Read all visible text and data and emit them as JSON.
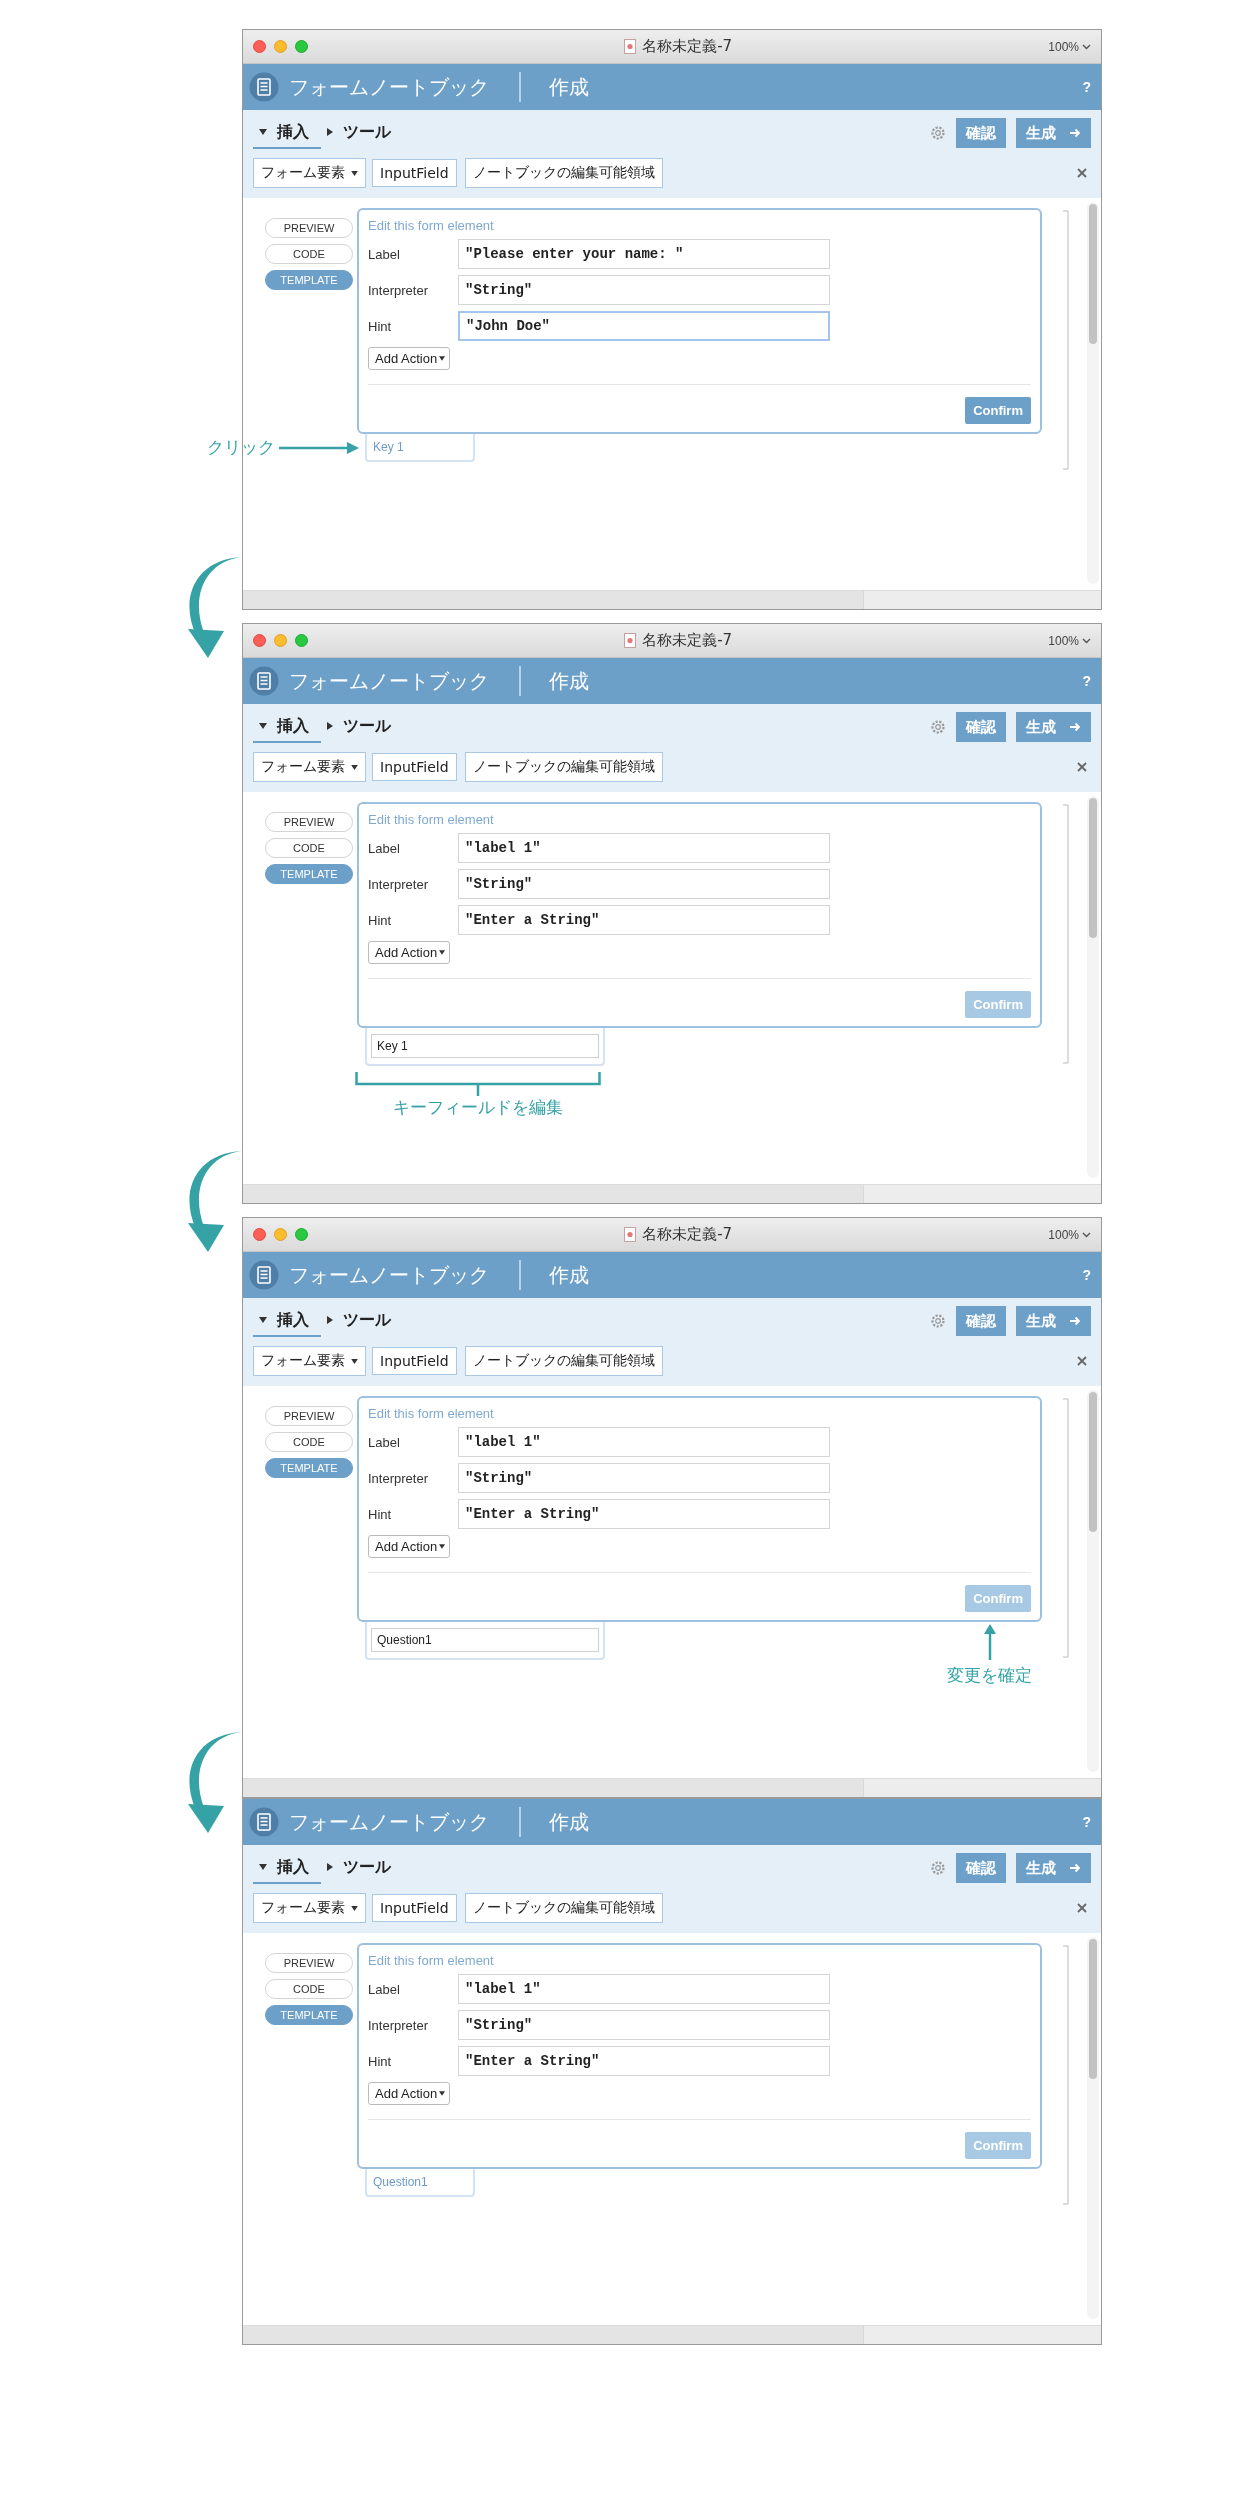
{
  "steps": [
    {
      "titlebar": {
        "title": "名称未定義-7",
        "zoom": "100%"
      },
      "header": {
        "app_name": "フォームノートブック",
        "mode": "作成",
        "help": "?"
      },
      "tabs": [
        {
          "label": "挿入",
          "expanded": true,
          "selected": true
        },
        {
          "label": "ツール",
          "expanded": false,
          "selected": false
        }
      ],
      "actions": [
        "確認",
        "生成"
      ],
      "breadcrumb": [
        "フォーム要素",
        "InputField",
        "ノートブックの編集可能領域"
      ],
      "view_modes": [
        {
          "label": "PREVIEW",
          "selected": false
        },
        {
          "label": "CODE",
          "selected": false
        },
        {
          "label": "TEMPLATE",
          "selected": true
        }
      ],
      "editor": {
        "title": "Edit this form element",
        "fields": [
          {
            "label": "Label",
            "value": "\"Please enter your name: \"",
            "focused": false
          },
          {
            "label": "Interpreter",
            "value": "\"String\"",
            "focused": false
          },
          {
            "label": "Hint",
            "value": "\"John Doe\"",
            "focused": true
          }
        ],
        "add_action": "Add Action",
        "confirm": {
          "label": "Confirm",
          "disabled": false
        }
      },
      "key_field": {
        "value": "Key 1",
        "editing": false
      },
      "annotation": {
        "kind": "arrow-left",
        "text": "クリック"
      }
    },
    {
      "titlebar": {
        "title": "名称未定義-7",
        "zoom": "100%"
      },
      "header": {
        "app_name": "フォームノートブック",
        "mode": "作成",
        "help": "?"
      },
      "tabs": [
        {
          "label": "挿入",
          "expanded": true,
          "selected": true
        },
        {
          "label": "ツール",
          "expanded": false,
          "selected": false
        }
      ],
      "actions": [
        "確認",
        "生成"
      ],
      "breadcrumb": [
        "フォーム要素",
        "InputField",
        "ノートブックの編集可能領域"
      ],
      "view_modes": [
        {
          "label": "PREVIEW",
          "selected": false
        },
        {
          "label": "CODE",
          "selected": false
        },
        {
          "label": "TEMPLATE",
          "selected": true
        }
      ],
      "editor": {
        "title": "Edit this form element",
        "fields": [
          {
            "label": "Label",
            "value": "\"label 1\"",
            "focused": false
          },
          {
            "label": "Interpreter",
            "value": "\"String\"",
            "focused": false
          },
          {
            "label": "Hint",
            "value": "\"Enter a String\"",
            "focused": false
          }
        ],
        "add_action": "Add Action",
        "confirm": {
          "label": "Confirm",
          "disabled": true
        }
      },
      "key_field": {
        "value": "Key 1",
        "editing": true
      },
      "annotation": {
        "kind": "bracket",
        "text": "キーフィールドを編集"
      }
    },
    {
      "titlebar": {
        "title": "名称未定義-7",
        "zoom": "100%"
      },
      "header": {
        "app_name": "フォームノートブック",
        "mode": "作成",
        "help": "?"
      },
      "tabs": [
        {
          "label": "挿入",
          "expanded": true,
          "selected": true
        },
        {
          "label": "ツール",
          "expanded": false,
          "selected": false
        }
      ],
      "actions": [
        "確認",
        "生成"
      ],
      "breadcrumb": [
        "フォーム要素",
        "InputField",
        "ノートブックの編集可能領域"
      ],
      "view_modes": [
        {
          "label": "PREVIEW",
          "selected": false
        },
        {
          "label": "CODE",
          "selected": false
        },
        {
          "label": "TEMPLATE",
          "selected": true
        }
      ],
      "editor": {
        "title": "Edit this form element",
        "fields": [
          {
            "label": "Label",
            "value": "\"label 1\"",
            "focused": false
          },
          {
            "label": "Interpreter",
            "value": "\"String\"",
            "focused": false
          },
          {
            "label": "Hint",
            "value": "\"Enter a String\"",
            "focused": false
          }
        ],
        "add_action": "Add Action",
        "confirm": {
          "label": "Confirm",
          "disabled": true
        }
      },
      "key_field": {
        "value": "Question1",
        "editing": true
      },
      "annotation": {
        "kind": "arrow-up",
        "text": "変更を確定"
      }
    },
    {
      "header": {
        "app_name": "フォームノートブック",
        "mode": "作成",
        "help": "?"
      },
      "tabs": [
        {
          "label": "挿入",
          "expanded": true,
          "selected": true
        },
        {
          "label": "ツール",
          "expanded": false,
          "selected": false
        }
      ],
      "actions": [
        "確認",
        "生成"
      ],
      "breadcrumb": [
        "フォーム要素",
        "InputField",
        "ノートブックの編集可能領域"
      ],
      "view_modes": [
        {
          "label": "PREVIEW",
          "selected": false
        },
        {
          "label": "CODE",
          "selected": false
        },
        {
          "label": "TEMPLATE",
          "selected": true
        }
      ],
      "editor": {
        "title": "Edit this form element",
        "fields": [
          {
            "label": "Label",
            "value": "\"label 1\"",
            "focused": false
          },
          {
            "label": "Interpreter",
            "value": "\"String\"",
            "focused": false
          },
          {
            "label": "Hint",
            "value": "\"Enter a String\"",
            "focused": false
          }
        ],
        "add_action": "Add Action",
        "confirm": {
          "label": "Confirm",
          "disabled": true
        }
      },
      "key_field": {
        "value": "Question1",
        "editing": false
      }
    }
  ]
}
